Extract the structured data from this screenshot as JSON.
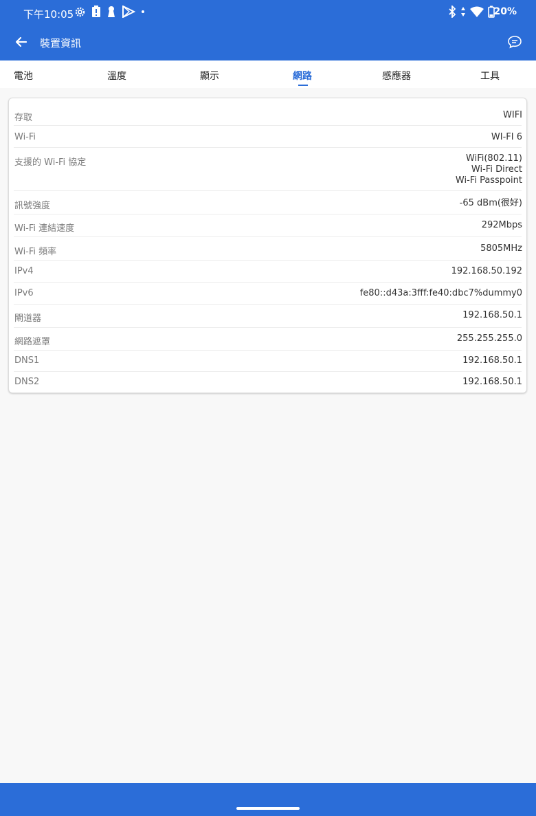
{
  "status_bar": {
    "time": "下午10:05",
    "battery": "20%",
    "left_icons": [
      "settings-icon",
      "battery-alert-icon",
      "keyhole-icon",
      "play-store-icon",
      "dot-icon"
    ],
    "right_icons": [
      "bluetooth-icon",
      "data-arrows-icon",
      "wifi-icon",
      "battery-icon"
    ]
  },
  "app_bar": {
    "title": "裝置資訊",
    "back_icon": "arrow-left-icon",
    "action_icon": "chat-icon"
  },
  "tabs": [
    {
      "label": "電池"
    },
    {
      "label": "溫度"
    },
    {
      "label": "顯示"
    },
    {
      "label": "網路",
      "active": true
    },
    {
      "label": "感應器"
    },
    {
      "label": "工具"
    }
  ],
  "rows": [
    {
      "label": "存取",
      "value": "WIFI"
    },
    {
      "label": "Wi-Fi",
      "value": "WI-FI 6"
    },
    {
      "label": "支援的 Wi-Fi 協定",
      "value": [
        "WiFi(802.11)",
        "Wi-Fi Direct",
        "Wi-Fi Passpoint"
      ]
    },
    {
      "label": "訊號強度",
      "value": "-65 dBm(很好)"
    },
    {
      "label": "Wi-Fi 連結速度",
      "value": "292Mbps"
    },
    {
      "label": "Wi-Fi 頻率",
      "value": "5805MHz"
    },
    {
      "label": "IPv4",
      "value": "192.168.50.192"
    },
    {
      "label": "IPv6",
      "value": "fe80::d43a:3fff:fe40:dbc7%dummy0"
    },
    {
      "label": "閘道器",
      "value": "192.168.50.1"
    },
    {
      "label": "網路遮罩",
      "value": "255.255.255.0"
    },
    {
      "label": "DNS1",
      "value": "192.168.50.1"
    },
    {
      "label": "DNS2",
      "value": "192.168.50.1"
    }
  ],
  "colors": {
    "primary": "#2b6dd8",
    "background": "#f8f8f8",
    "card": "#ffffff"
  }
}
